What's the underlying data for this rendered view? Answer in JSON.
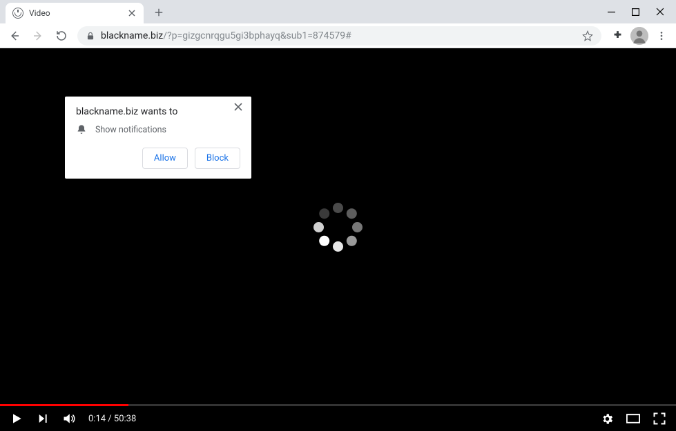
{
  "tab": {
    "title": "Video"
  },
  "url_host": "blackname.biz",
  "url_path": "/?p=gizgcnrqgu5gi3bphayq&sub1=874579#",
  "permission": {
    "title": "blackname.biz wants to",
    "line": "Show notifications",
    "allow": "Allow",
    "block": "Block"
  },
  "video": {
    "current": "0:14",
    "duration": "50:38",
    "separator": " / ",
    "progress_pct": 19
  }
}
